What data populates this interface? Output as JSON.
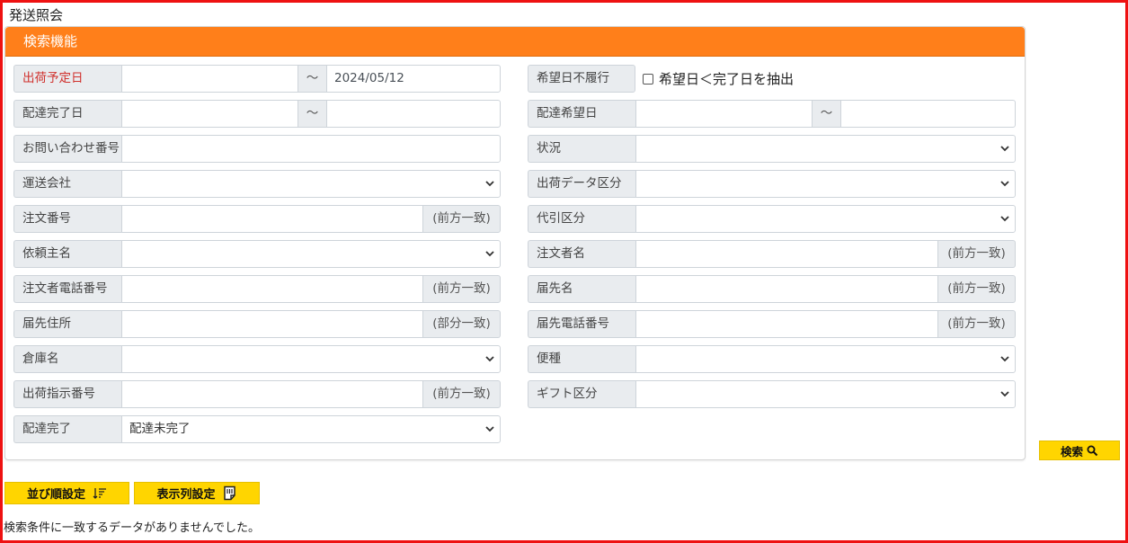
{
  "page": {
    "title": "発送照会"
  },
  "panel": {
    "header": "検索機能"
  },
  "fields": {
    "ship_date": {
      "label": "出荷予定日",
      "from": "",
      "to": "2024/05/12",
      "sep": "～"
    },
    "delivered_date": {
      "label": "配達完了日",
      "from": "",
      "to": "",
      "sep": "～"
    },
    "inquiry_no": {
      "label": "お問い合わせ番号",
      "value": ""
    },
    "carrier": {
      "label": "運送会社",
      "value": ""
    },
    "order_no": {
      "label": "注文番号",
      "value": "",
      "suffix": "(前方一致)"
    },
    "client_name": {
      "label": "依頼主名",
      "value": ""
    },
    "orderer_phone": {
      "label": "注文者電話番号",
      "value": "",
      "suffix": "(前方一致)"
    },
    "dest_address": {
      "label": "届先住所",
      "value": "",
      "suffix": "(部分一致)"
    },
    "warehouse": {
      "label": "倉庫名",
      "value": ""
    },
    "ship_instruction_no": {
      "label": "出荷指示番号",
      "value": "",
      "suffix": "(前方一致)"
    },
    "delivery_done": {
      "label": "配達完了",
      "value": "配達未完了"
    },
    "desired_unfulfilled": {
      "label": "希望日不履行",
      "checkbox_label": "希望日＜完了日を抽出",
      "checked": false
    },
    "desired_date": {
      "label": "配達希望日",
      "from": "",
      "to": "",
      "sep": "～"
    },
    "status": {
      "label": "状況",
      "value": ""
    },
    "ship_data_type": {
      "label": "出荷データ区分",
      "value": ""
    },
    "cod_type": {
      "label": "代引区分",
      "value": ""
    },
    "orderer_name": {
      "label": "注文者名",
      "value": "",
      "suffix": "(前方一致)"
    },
    "dest_name": {
      "label": "届先名",
      "value": "",
      "suffix": "(前方一致)"
    },
    "dest_phone": {
      "label": "届先電話番号",
      "value": "",
      "suffix": "(前方一致)"
    },
    "service_type": {
      "label": "便種",
      "value": ""
    },
    "gift_type": {
      "label": "ギフト区分",
      "value": ""
    }
  },
  "buttons": {
    "search": "検索",
    "sort_settings": "並び順設定",
    "column_settings": "表示列設定"
  },
  "message": "検索条件に一致するデータがありませんでした。",
  "icons": {
    "search": "magnifier-icon",
    "sort": "sort-icon",
    "columns": "column-settings-icon",
    "dropdown": "chevron-down-icon"
  },
  "colors": {
    "header": "#ff7f1a",
    "button": "#ffd500",
    "border_highlight": "#ee1111",
    "required_label": "#d0312d"
  }
}
